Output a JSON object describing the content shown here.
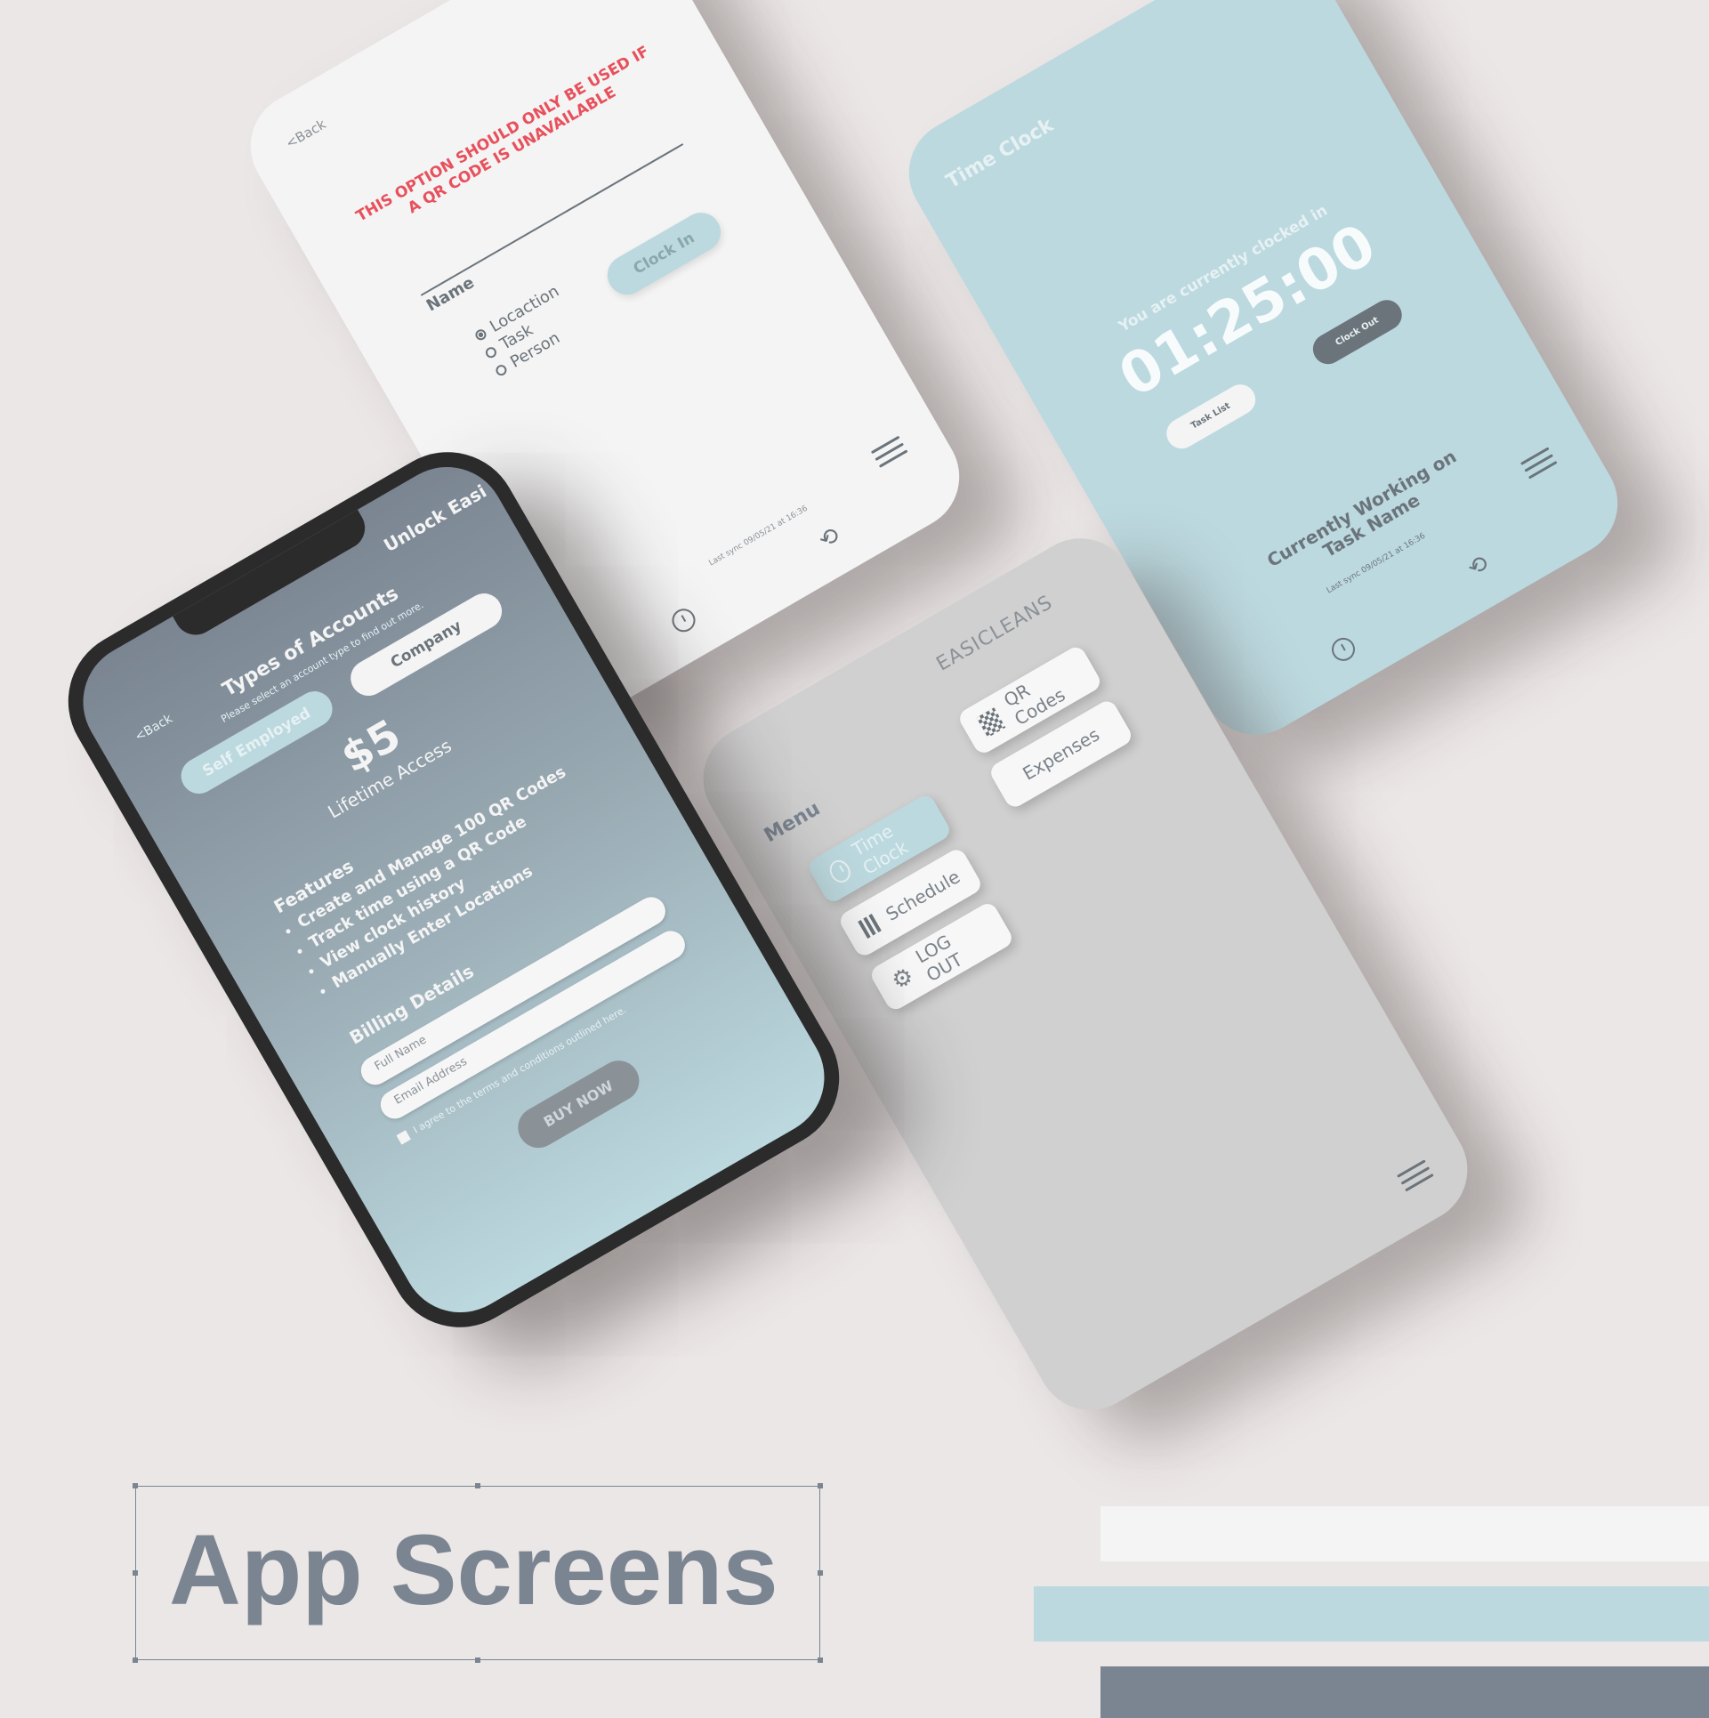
{
  "page": {
    "title": "App Screens"
  },
  "manual_screen": {
    "back": "<Back",
    "warning": "THIS OPTION SHOULD ONLY BE USED IF A QR CODE IS UNAVAILABLE",
    "name_label": "Name",
    "options": [
      "Locaction",
      "Task",
      "Person"
    ],
    "selected_option": "Locaction",
    "clock_in": "Clock In",
    "last_sync": "Last sync 09/05/21 at 16:36"
  },
  "timeclock_screen": {
    "title": "Time Clock",
    "status": "You are currently clocked in",
    "timer": "01:25:00",
    "clock_out": "Clock Out",
    "task_list": "Task List",
    "working_on": "Currently Working on",
    "task_name": "Task Name",
    "last_sync": "Last sync 09/05/21 at 16:36"
  },
  "menu_screen": {
    "brand": "EASICLEANS",
    "title": "Menu",
    "items": [
      {
        "label": "QR Codes",
        "icon": "qr-code-icon"
      },
      {
        "label": "Expenses",
        "icon": ""
      },
      {
        "label": "Time Clock",
        "icon": "clock-icon"
      },
      {
        "label": "Schedule",
        "icon": "calendar-grid-icon"
      },
      {
        "label": "LOG OUT",
        "icon": "gear-icon"
      }
    ]
  },
  "accounts_screen": {
    "header": "Unlock Easi",
    "back": "<Back",
    "title": "Types of Accounts",
    "subtitle": "Please select an account type to find out more.",
    "tab_company": "Company",
    "tab_self_employed": "Self Employed",
    "price": "$5",
    "price_caption": "Lifetime Access",
    "features_title": "Features",
    "features": [
      "Create and Manage 100 QR Codes",
      "Track time using a QR Code",
      "View clock history",
      "Manually Enter Locations"
    ],
    "billing_title": "Billing Details",
    "full_name_placeholder": "Full Name",
    "email_placeholder": "Email Address",
    "agree_text": "I agree to the terms and conditions outlined here.",
    "buy_now": "BUY NOW"
  },
  "colors": {
    "background": "#ebe7e6",
    "light_blue": "#bcd9df",
    "slate": "#7a8591",
    "off_white": "#f4f4f4",
    "warning_red": "#e8505b"
  }
}
